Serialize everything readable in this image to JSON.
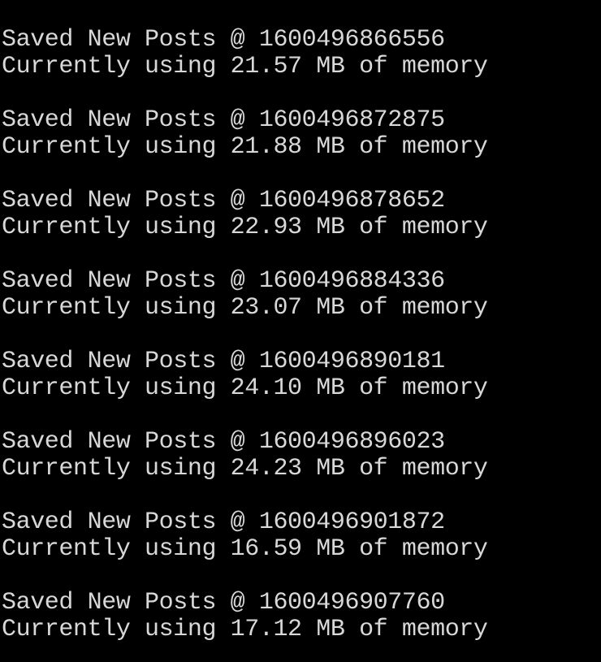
{
  "terminal": {
    "colors": {
      "background": "#000000",
      "text": "#d8d8d8"
    },
    "entries": [
      {
        "saved": "Saved New Posts @ 1600496866556",
        "memory": "Currently using 21.57 MB of memory"
      },
      {
        "saved": "Saved New Posts @ 1600496872875",
        "memory": "Currently using 21.88 MB of memory"
      },
      {
        "saved": "Saved New Posts @ 1600496878652",
        "memory": "Currently using 22.93 MB of memory"
      },
      {
        "saved": "Saved New Posts @ 1600496884336",
        "memory": "Currently using 23.07 MB of memory"
      },
      {
        "saved": "Saved New Posts @ 1600496890181",
        "memory": "Currently using 24.10 MB of memory"
      },
      {
        "saved": "Saved New Posts @ 1600496896023",
        "memory": "Currently using 24.23 MB of memory"
      },
      {
        "saved": "Saved New Posts @ 1600496901872",
        "memory": "Currently using 16.59 MB of memory"
      },
      {
        "saved": "Saved New Posts @ 1600496907760",
        "memory": "Currently using 17.12 MB of memory"
      }
    ]
  }
}
